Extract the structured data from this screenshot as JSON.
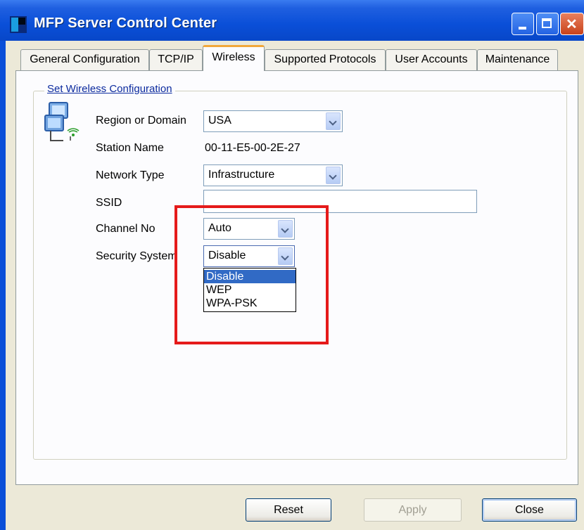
{
  "window": {
    "title": "MFP Server Control Center"
  },
  "tabs": [
    {
      "label": "General Configuration",
      "active": false
    },
    {
      "label": "TCP/IP",
      "active": false
    },
    {
      "label": "Wireless",
      "active": true
    },
    {
      "label": "Supported Protocols",
      "active": false
    },
    {
      "label": "User Accounts",
      "active": false
    },
    {
      "label": "Maintenance",
      "active": false
    }
  ],
  "group": {
    "title": "Set Wireless Configuration"
  },
  "fields": {
    "region": {
      "label": "Region or Domain",
      "value": "USA"
    },
    "station": {
      "label": "Station Name",
      "value": "00-11-E5-00-2E-27"
    },
    "network_type": {
      "label": "Network Type",
      "value": "Infrastructure"
    },
    "ssid": {
      "label": "SSID",
      "value": ""
    },
    "channel": {
      "label": "Channel No",
      "value": "Auto"
    },
    "security": {
      "label": "Security System",
      "value": "Disable",
      "options": [
        "Disable",
        "WEP",
        "WPA-PSK"
      ],
      "highlighted": "Disable"
    }
  },
  "buttons": {
    "reset": "Reset",
    "apply": "Apply",
    "close": "Close"
  },
  "colors": {
    "title_bar": "#0a4fd8",
    "highlight": "#e51a1a",
    "selection": "#316ac5"
  }
}
